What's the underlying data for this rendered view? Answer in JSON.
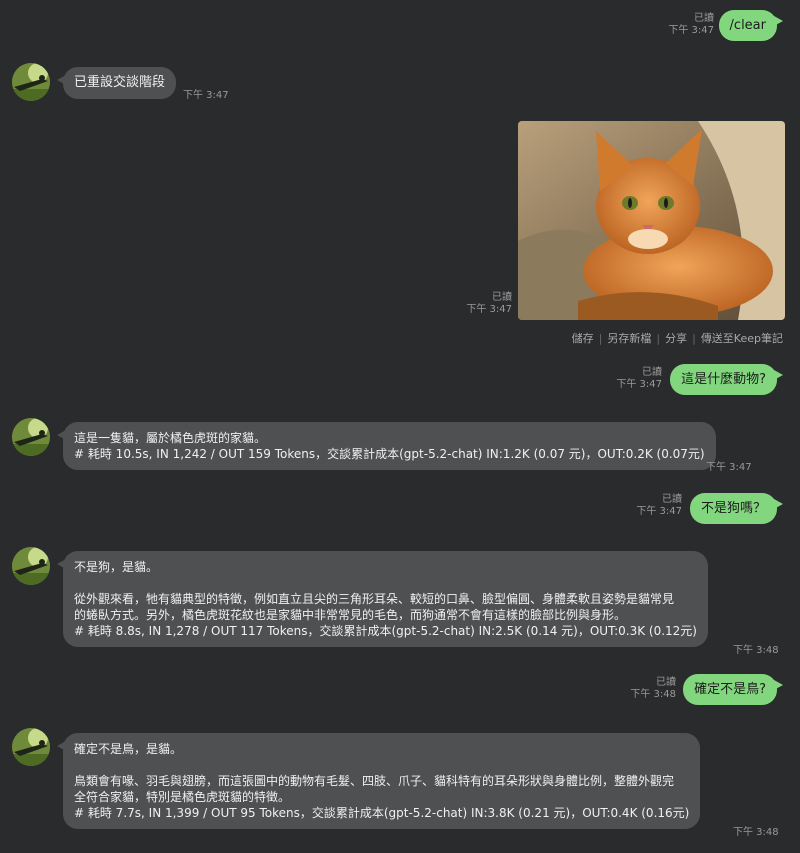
{
  "messages": {
    "m1": {
      "text": "/clear",
      "read": "已讀",
      "time": "下午 3:47"
    },
    "m2": {
      "text": "已重設交談階段",
      "time": "下午 3:47"
    },
    "m3": {
      "read": "已讀",
      "time": "下午 3:47"
    },
    "m4": {
      "text": "這是什麼動物?",
      "read": "已讀",
      "time": "下午 3:47"
    },
    "m5": {
      "lines": [
        "這是一隻貓，屬於橘色虎斑的家貓。",
        " # 耗時 10.5s, IN 1,242 / OUT 159 Tokens，交談累計成本(gpt-5.2-chat) IN:1.2K (0.07 元)，OUT:0.2K (0.07元)"
      ],
      "time": "下午 3:47"
    },
    "m6": {
      "text": "不是狗嗎？",
      "read": "已讀",
      "time": "下午 3:47"
    },
    "m7": {
      "line1": "不是狗，是貓。",
      "line2": "從外觀來看，牠有貓典型的特徵，例如直立且尖的三角形耳朵、較短的口鼻、臉型偏圓、身體柔軟且姿勢是貓常見",
      "line3": "的蜷臥方式。另外，橘色虎斑花紋也是家貓中非常常見的毛色，而狗通常不會有這樣的臉部比例與身形。",
      "line4": " # 耗時 8.8s, IN 1,278 / OUT 117 Tokens，交談累計成本(gpt-5.2-chat) IN:2.5K (0.14 元)，OUT:0.3K (0.12元)",
      "time": "下午 3:48"
    },
    "m8": {
      "text": "確定不是鳥?",
      "read": "已讀",
      "time": "下午 3:48"
    },
    "m9": {
      "line1": "確定不是鳥，是貓。",
      "line2": "鳥類會有喙、羽毛與翅膀，而這張圖中的動物有毛髮、四肢、爪子、貓科特有的耳朵形狀與身體比例，整體外觀完",
      "line3": "全符合家貓，特別是橘色虎斑貓的特徵。",
      "line4": " # 耗時 7.7s, IN 1,399 / OUT 95 Tokens，交談累計成本(gpt-5.2-chat) IN:3.8K (0.21 元)，OUT:0.4K (0.16元)",
      "time": "下午 3:48"
    }
  },
  "image_actions": [
    "儲存",
    "另存新檔",
    "分享",
    "傳送至Keep筆記"
  ],
  "colors": {
    "background": "#2a2b2d",
    "outgoing": "#82d77e",
    "incoming": "#4f5052",
    "meta": "#9a9a9a"
  }
}
